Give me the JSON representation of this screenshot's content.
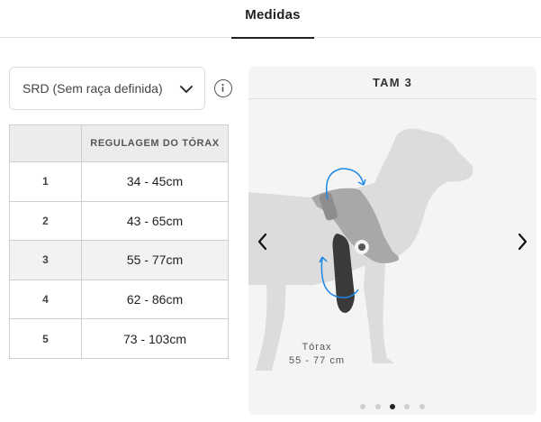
{
  "tabs": [
    {
      "label": "Medidas",
      "active": true
    }
  ],
  "breed_select": {
    "value": "SRD (Sem raça definida)",
    "icon": "chevron-down-icon"
  },
  "info_button": {
    "icon": "info-icon"
  },
  "size_table": {
    "headers": [
      "",
      "REGULAGEM DO TÓRAX"
    ],
    "rows": [
      {
        "size": "1",
        "range": "34 - 45cm"
      },
      {
        "size": "2",
        "range": "43 - 65cm"
      },
      {
        "size": "3",
        "range": "55 - 77cm"
      },
      {
        "size": "4",
        "range": "62 - 86cm"
      },
      {
        "size": "5",
        "range": "73 - 103cm"
      }
    ]
  },
  "carousel": {
    "title": "TAM 3",
    "figure": {
      "caption_label": "Tórax",
      "caption_value": "55 - 77 cm"
    },
    "prev_icon": "chevron-left-icon",
    "next_icon": "chevron-right-icon",
    "dots_count": 5,
    "active_dot_index": 2
  },
  "colors": {
    "accent_arrow": "#1e88e5",
    "dog_silhouette": "#dcdcdc",
    "harness": "#a8a8a8",
    "strap": "#3a3a3a"
  }
}
